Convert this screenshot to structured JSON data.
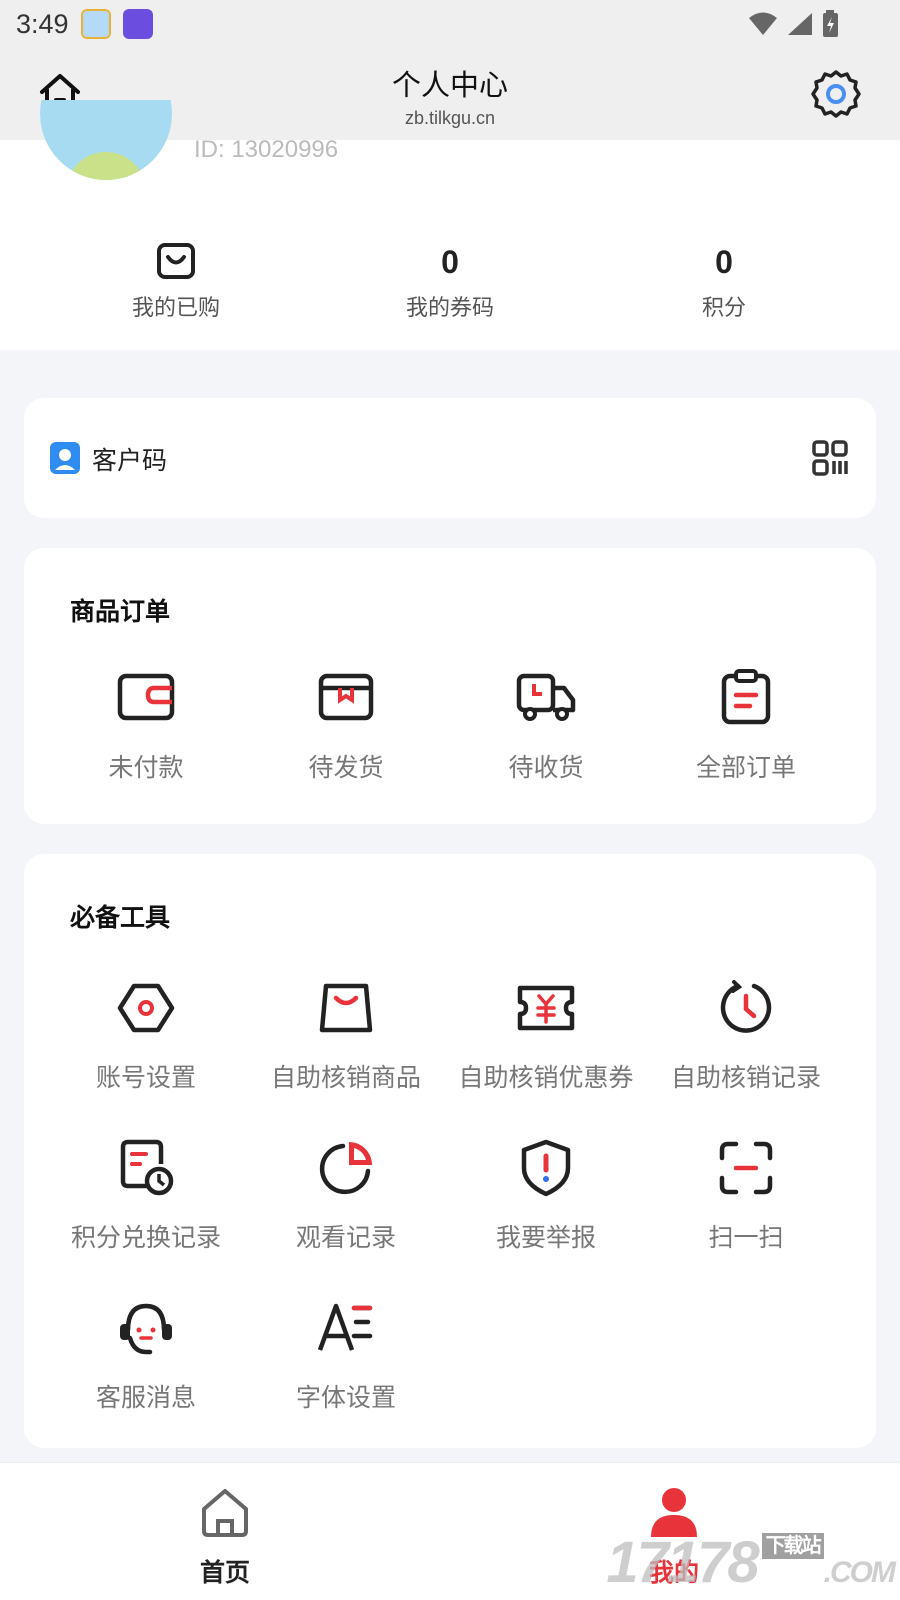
{
  "status": {
    "time": "3:49"
  },
  "header": {
    "title": "个人中心",
    "url": "zb.tilkgu.cn"
  },
  "profile": {
    "user_id": "ID: 13020996"
  },
  "stats": [
    {
      "icon": "shopping-bag-icon",
      "label": "我的已购"
    },
    {
      "value": "0",
      "label": "我的券码"
    },
    {
      "value": "0",
      "label": "积分"
    }
  ],
  "customer_code": {
    "label": "客户码",
    "icon": "user-badge-icon",
    "qr_icon": "qr-code-icon"
  },
  "orders": {
    "title": "商品订单",
    "items": [
      {
        "label": "未付款",
        "icon": "wallet-icon"
      },
      {
        "label": "待发货",
        "icon": "package-icon"
      },
      {
        "label": "待收货",
        "icon": "truck-icon"
      },
      {
        "label": "全部订单",
        "icon": "clipboard-icon"
      }
    ]
  },
  "tools": {
    "title": "必备工具",
    "items": [
      {
        "label": "账号设置",
        "icon": "hexagon-settings-icon"
      },
      {
        "label": "自助核销商品",
        "icon": "shopping-bag-icon"
      },
      {
        "label": "自助核销优惠券",
        "icon": "coupon-icon"
      },
      {
        "label": "自助核销记录",
        "icon": "history-icon"
      },
      {
        "label": "积分兑换记录",
        "icon": "record-clock-icon"
      },
      {
        "label": "观看记录",
        "icon": "pie-chart-icon"
      },
      {
        "label": "我要举报",
        "icon": "shield-alert-icon"
      },
      {
        "label": "扫一扫",
        "icon": "scan-icon"
      },
      {
        "label": "客服消息",
        "icon": "customer-service-icon"
      },
      {
        "label": "字体设置",
        "icon": "font-icon"
      }
    ]
  },
  "tabbar": {
    "items": [
      {
        "label": "首页",
        "icon": "home-icon",
        "active": false
      },
      {
        "label": "我的",
        "icon": "user-icon",
        "active": true
      }
    ]
  },
  "colors": {
    "accent": "#e8333b",
    "icon_stroke": "#222222",
    "label_gray": "#777777",
    "page_bg": "#f4f5f8"
  },
  "watermark": {
    "text": "17178",
    "tag": "下载站",
    "suffix": ".COM"
  }
}
